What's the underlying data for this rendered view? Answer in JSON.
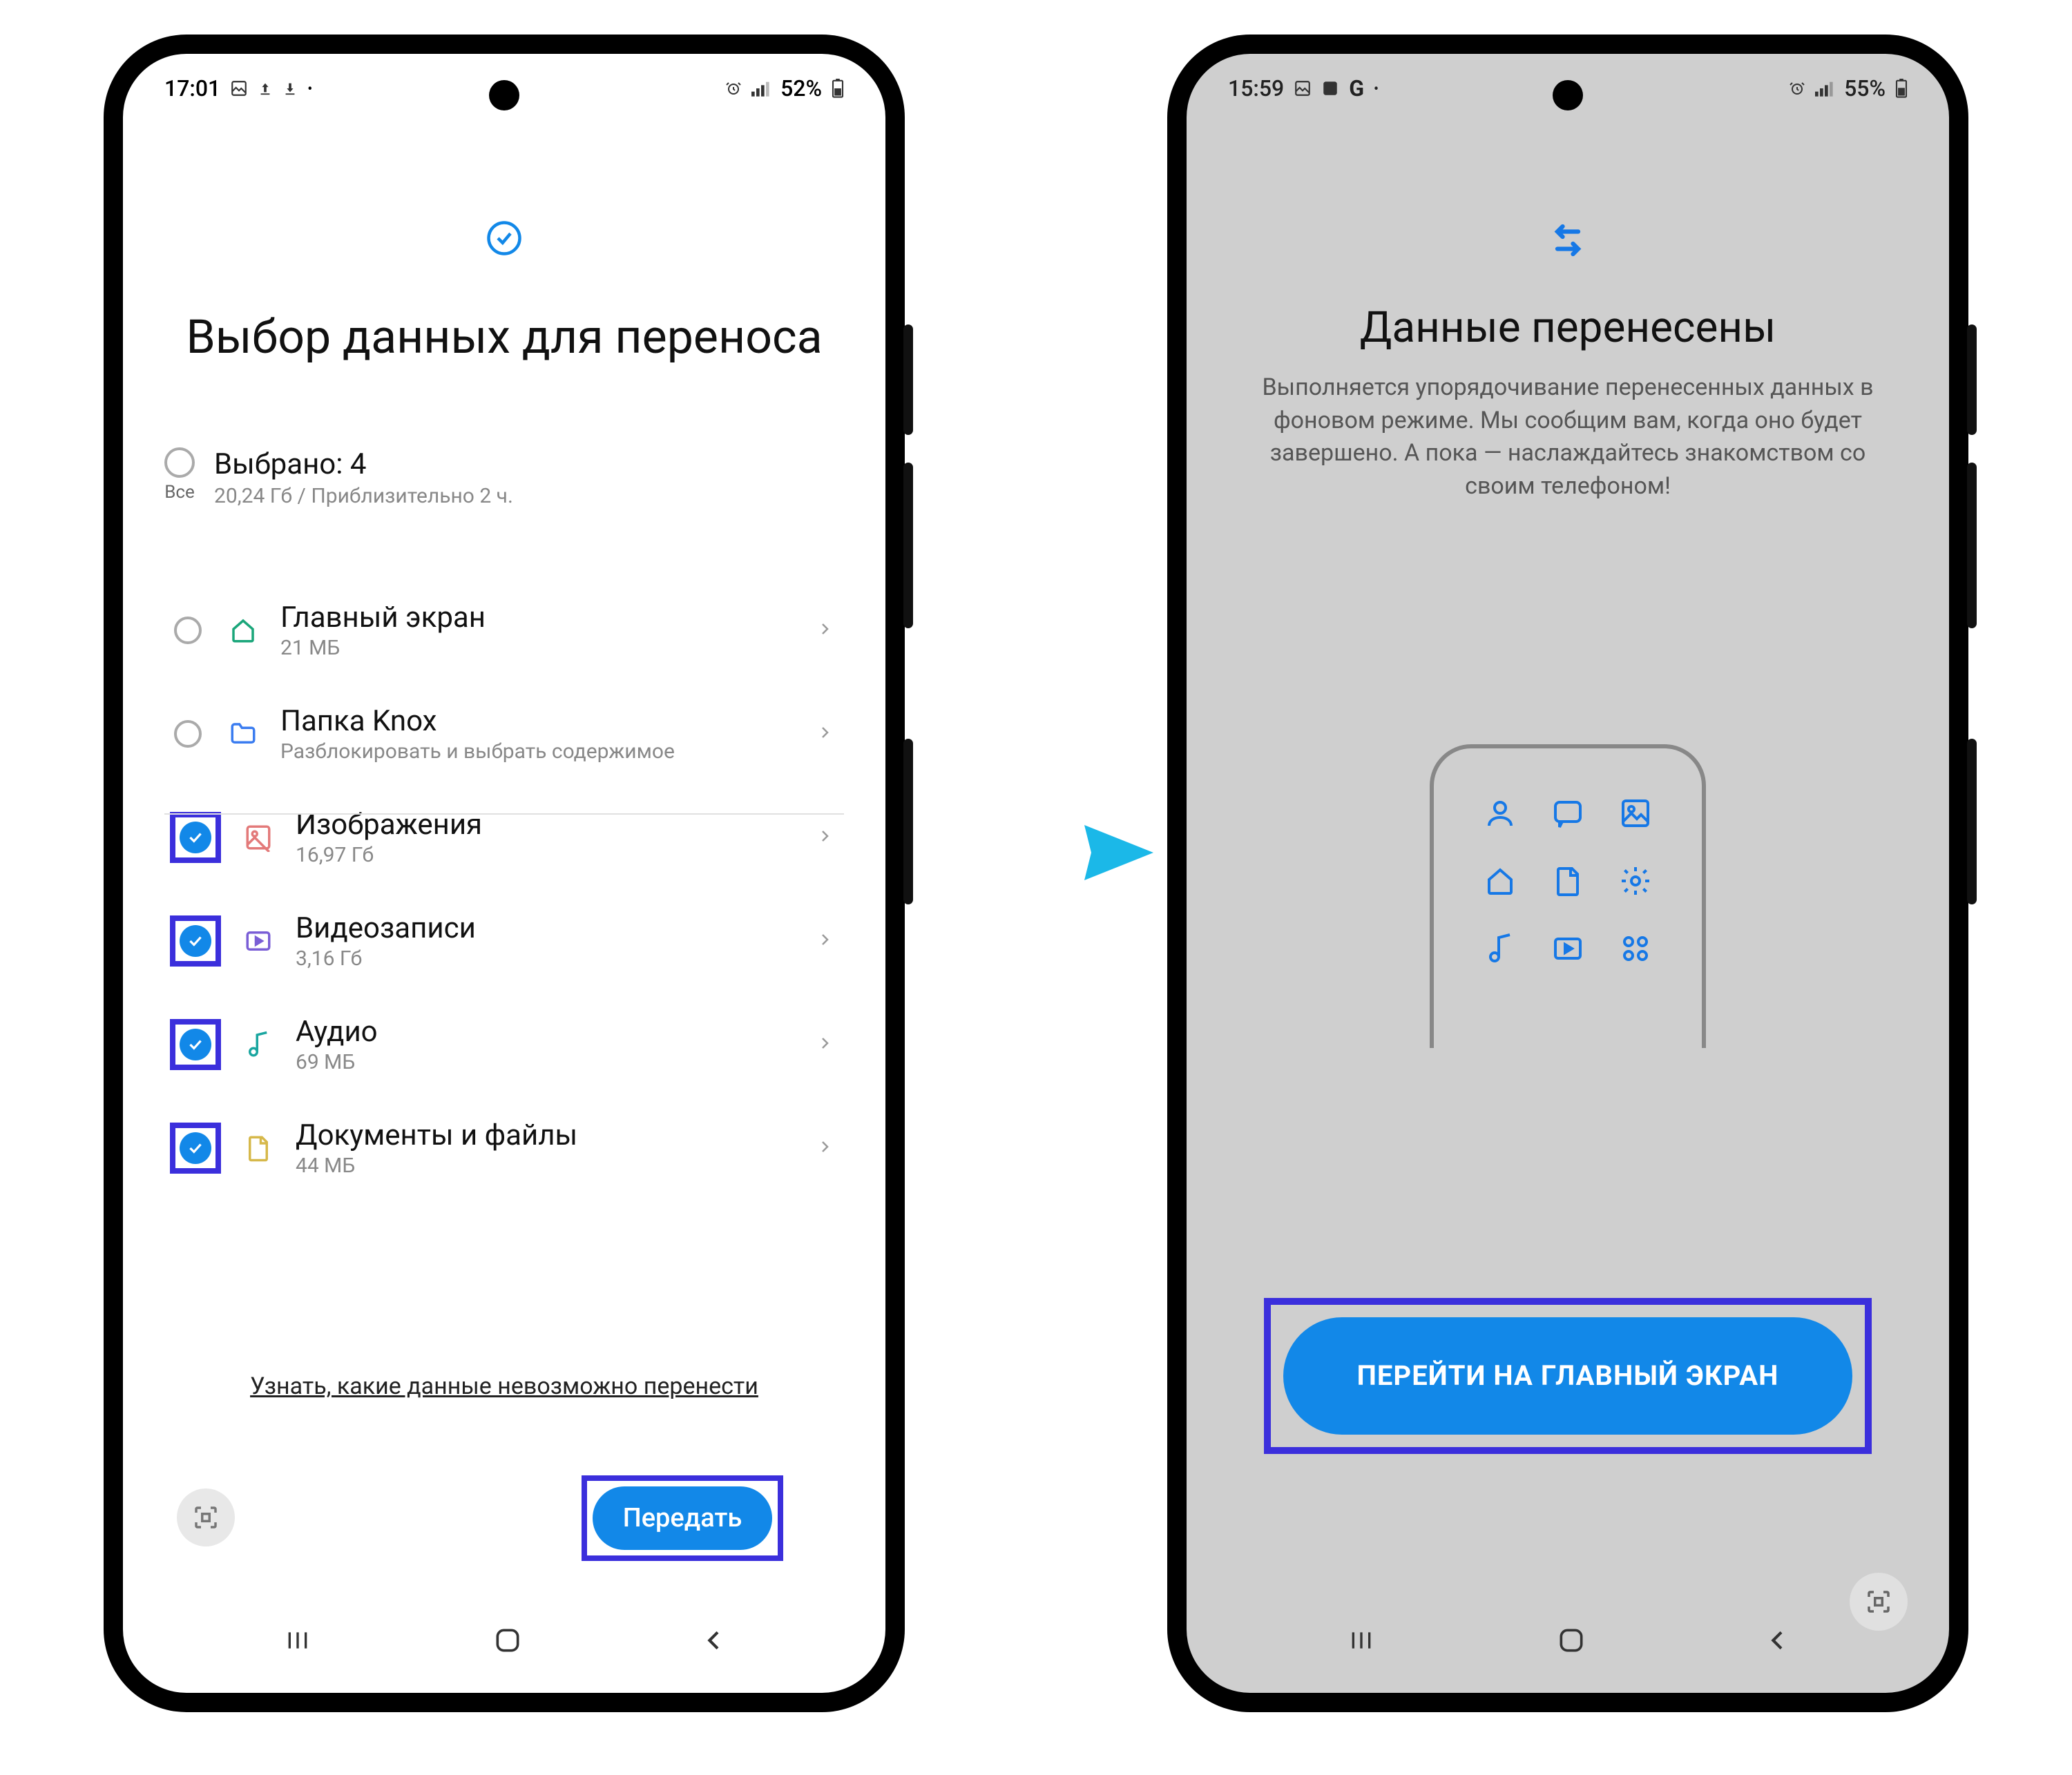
{
  "left": {
    "status": {
      "time": "17:01",
      "battery": "52%"
    },
    "title": "Выбор данных для переноса",
    "all_label": "Все",
    "summary": {
      "selected": "Выбрано: 4",
      "detail": "20,24 Гб / Приблизительно 2 ч."
    },
    "rows": [
      {
        "label": "Главный экран",
        "sub": "21 МБ",
        "checked": false,
        "icon": "home",
        "color": "#1aa67a"
      },
      {
        "label": "Папка Knox",
        "sub": "Разблокировать и выбрать содержимое",
        "checked": false,
        "icon": "folder",
        "color": "#3a7cf0"
      },
      {
        "label": "Изображения",
        "sub": "16,97 Гб",
        "checked": true,
        "icon": "image",
        "color": "#e37a7a"
      },
      {
        "label": "Видеозаписи",
        "sub": "3,16 Гб",
        "checked": true,
        "icon": "video",
        "color": "#7a5ed6"
      },
      {
        "label": "Аудио",
        "sub": "69 МБ",
        "checked": true,
        "icon": "audio",
        "color": "#1aa6a0"
      },
      {
        "label": "Документы и файлы",
        "sub": "44 МБ",
        "checked": true,
        "icon": "doc",
        "color": "#d6b84a"
      }
    ],
    "link": "Узнать, какие данные невозможно перенести",
    "button": "Передать"
  },
  "right": {
    "status": {
      "time": "15:59",
      "battery": "55%"
    },
    "title": "Данные перенесены",
    "subtitle": "Выполняется упорядочивание перенесенных данных в фоновом режиме. Мы сообщим вам, когда оно будет завершено. А пока — наслаждайтесь знакомством со своим телефоном!",
    "button": "ПЕРЕЙТИ НА ГЛАВНЫЙ ЭКРАН"
  }
}
